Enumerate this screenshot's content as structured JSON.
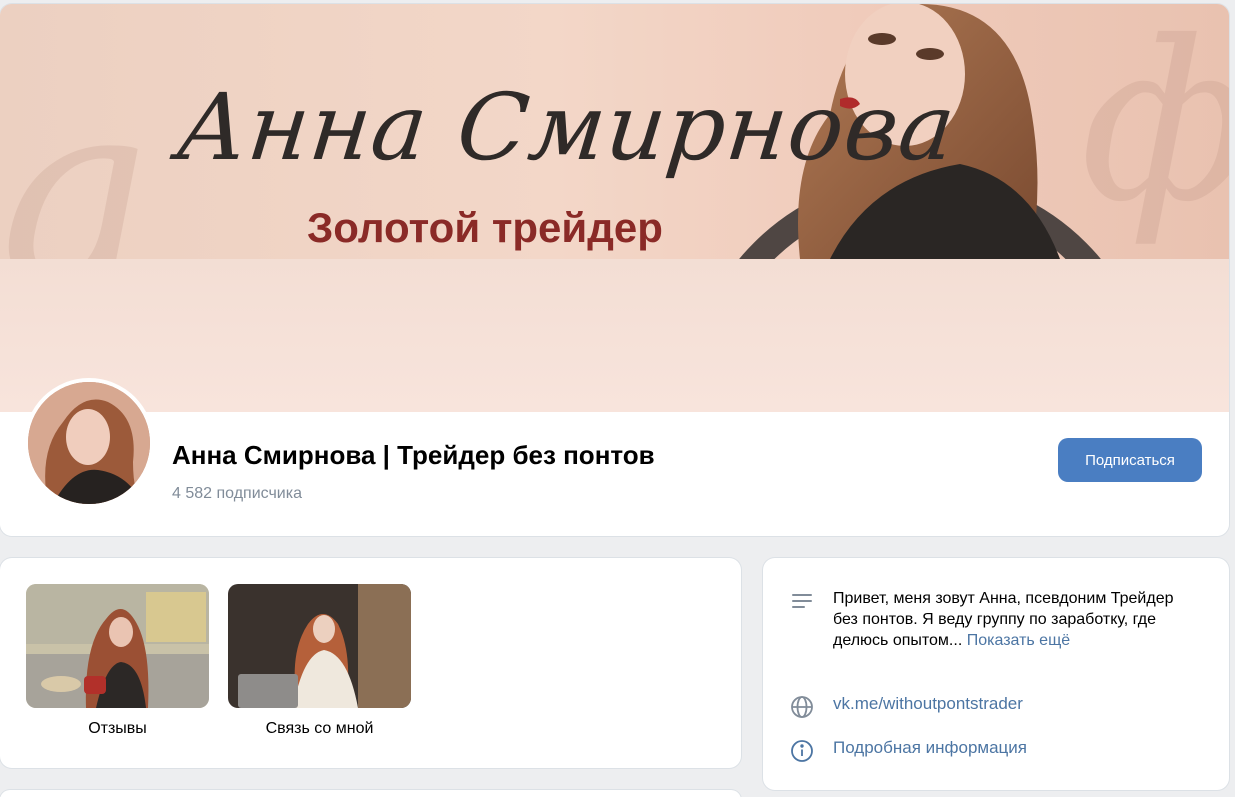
{
  "cover": {
    "script_name": "Анна Смирнова",
    "subtitle": "Золотой трейдер"
  },
  "profile": {
    "title": "Анна Смирнова | Трейдер без понтов",
    "subscribers": "4 582 подписчика",
    "subscribe_label": "Подписаться"
  },
  "links": [
    {
      "label": "Отзывы"
    },
    {
      "label": "Связь со мной"
    }
  ],
  "about": {
    "text": "Привет, меня зовут Анна, псевдоним Трейдер без понтов. Я веду группу по заработку, где делюсь опытом...",
    "show_more": "Показать ещё",
    "site": "vk.me/withoutpontstrader",
    "details": "Подробная информация"
  },
  "colors": {
    "accent": "#4a7ec2",
    "link": "#4c75a3",
    "muted": "#818c99",
    "subtitle": "#8a2a27"
  },
  "icons": [
    "description-lines-icon",
    "globe-icon",
    "info-icon"
  ]
}
